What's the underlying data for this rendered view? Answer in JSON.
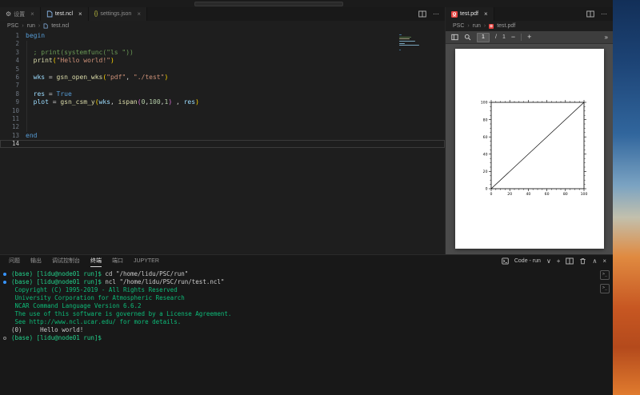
{
  "glyphs": {
    "close": "×",
    "chevron_down": "∨",
    "chevron_up": "∧",
    "plus": "+",
    "more": "⋯",
    "overflow": "»",
    "crumb_sep": "›",
    "minus": "−",
    "gear": "⚙",
    "json_braces": "{}",
    "rail_terminal": ">_"
  },
  "editor_group_left": {
    "tabs": [
      {
        "label": "设置"
      },
      {
        "label": "test.ncl",
        "active": true
      },
      {
        "label": "settings.json"
      }
    ],
    "breadcrumb": {
      "items": [
        "PSC",
        "run",
        "test.ncl"
      ]
    },
    "editor": {
      "lines": [
        {
          "seg": [
            [
              "kw",
              "begin"
            ]
          ]
        },
        {
          "seg": []
        },
        {
          "seg": [
            [
              "cmt",
              "  ; print(systemfunc(\"ls \"))"
            ]
          ]
        },
        {
          "seg": [
            [
              "pln",
              "  "
            ],
            [
              "fn",
              "print"
            ],
            [
              "br1",
              "("
            ],
            [
              "str",
              "\"Hello world!\""
            ],
            [
              "br1",
              ")"
            ]
          ]
        },
        {
          "seg": []
        },
        {
          "seg": [
            [
              "pln",
              "  "
            ],
            [
              "vr",
              "wks"
            ],
            [
              "pln",
              " = "
            ],
            [
              "fn",
              "gsn_open_wks"
            ],
            [
              "br1",
              "("
            ],
            [
              "str",
              "\"pdf\""
            ],
            [
              "pln",
              ", "
            ],
            [
              "str",
              "\"./test\""
            ],
            [
              "br1",
              ")"
            ]
          ]
        },
        {
          "seg": []
        },
        {
          "seg": [
            [
              "pln",
              "  "
            ],
            [
              "vr",
              "res"
            ],
            [
              "pln",
              " = "
            ],
            [
              "kw",
              "True"
            ]
          ]
        },
        {
          "seg": [
            [
              "pln",
              "  "
            ],
            [
              "vr",
              "plot"
            ],
            [
              "pln",
              " = "
            ],
            [
              "fn",
              "gsn_csm_y"
            ],
            [
              "br1",
              "("
            ],
            [
              "vr",
              "wks"
            ],
            [
              "pln",
              ", "
            ],
            [
              "fn",
              "ispan"
            ],
            [
              "br2",
              "("
            ],
            [
              "num",
              "0"
            ],
            [
              "pln",
              ","
            ],
            [
              "num",
              "100"
            ],
            [
              "pln",
              ","
            ],
            [
              "num",
              "1"
            ],
            [
              "br2",
              ")"
            ],
            [
              "pln",
              " , "
            ],
            [
              "vr",
              "res"
            ],
            [
              "br1",
              ")"
            ]
          ]
        },
        {
          "seg": []
        },
        {
          "seg": []
        },
        {
          "seg": []
        },
        {
          "seg": [
            [
              "kw",
              "end"
            ]
          ]
        },
        {
          "seg": [],
          "current": true
        }
      ]
    }
  },
  "editor_group_right": {
    "tabs": [
      {
        "label": "test.pdf",
        "active": true
      }
    ],
    "breadcrumb": {
      "items": [
        "PSC",
        "run",
        "test.pdf"
      ]
    },
    "toolbar": {
      "page_input": "1",
      "page_separator": "/",
      "page_total": "1"
    },
    "plot": {
      "type": "line",
      "x": [
        0,
        100
      ],
      "y": [
        0,
        100
      ],
      "x_ticks": [
        0,
        20,
        40,
        60,
        80,
        100
      ],
      "y_ticks": [
        0,
        20,
        40,
        60,
        80,
        100
      ],
      "xlim": [
        0,
        100
      ],
      "ylim": [
        0,
        100
      ],
      "minor_per_major": 3,
      "frame": true
    }
  },
  "panel": {
    "tabs": [
      {
        "label": "问题"
      },
      {
        "label": "输出"
      },
      {
        "label": "调试控制台"
      },
      {
        "label": "终端",
        "active": true
      },
      {
        "label": "端口"
      },
      {
        "label": "JUPYTER"
      }
    ],
    "controls": {
      "terminal_label": "Code - run"
    },
    "terminal": {
      "lines": [
        {
          "dec": "run",
          "seg": [
            [
              "p",
              "(base) [lidu@node01 run]$"
            ],
            [
              "c",
              " cd \"/home/lidu/PSC/run\""
            ]
          ]
        },
        {
          "dec": "run",
          "seg": [
            [
              "p",
              "(base) [lidu@node01 run]$"
            ],
            [
              "c",
              " ncl \"/home/lidu/PSC/run/test.ncl\""
            ]
          ]
        },
        {
          "seg": [
            [
              "o",
              " Copyright (C) 1995-2019 - All Rights Reserved"
            ]
          ]
        },
        {
          "seg": [
            [
              "o",
              " University Corporation for Atmospheric Research"
            ]
          ]
        },
        {
          "seg": [
            [
              "o",
              " NCAR Command Language Version 6.6.2"
            ]
          ]
        },
        {
          "seg": [
            [
              "o",
              " The use of this software is governed by a License Agreement."
            ]
          ]
        },
        {
          "seg": [
            [
              "o",
              " See http://www.ncl.ucar.edu/ for more details."
            ]
          ]
        },
        {
          "seg": [
            [
              "w",
              "(0)     Hello world!"
            ]
          ]
        },
        {
          "dec": "idle",
          "seg": [
            [
              "p",
              "(base) [lidu@node01 run]$"
            ]
          ]
        }
      ]
    }
  },
  "colors": {
    "accent": "#3794ff",
    "prompt_green": "#23d18b",
    "output_green": "#0dbc79",
    "pdf_red": "#e5413e"
  }
}
